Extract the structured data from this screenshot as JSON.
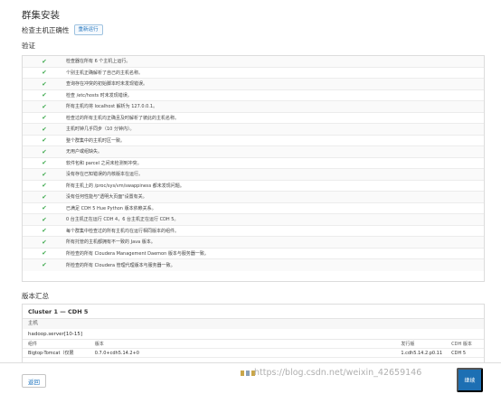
{
  "header": {
    "title": "群集安装",
    "subtitle": "检查主机正确性",
    "rerun_label": "重新运行"
  },
  "validation": {
    "heading": "验证",
    "checks": [
      "检查器在所有 6 个主机上运行。",
      "个别主机正确解析了自己的主机名称。",
      "查询存在冲突的初始脚本时未发现错误。",
      "检查 /etc/hosts 时未发现错误。",
      "所有主机均将 localhost 解析为 127.0.0.1。",
      "检查过的所有主机均正确且及时解析了彼此的主机名称。",
      "主机时钟几乎同步（10 分钟内）。",
      "整个群集中的主机时区一致。",
      "无用户或组缺失。",
      "软件包和 parcel 之间未检测到冲突。",
      "没有存在已知错误的内核版本在运行。",
      "所有主机上的 /proc/sys/vm/swappiness 都未发现问题。",
      "没有任何性能与\"透明大页面\"设置有关。",
      "已满足 CDH 5 Hue Python 版本依赖关系。",
      "0 台主机正在运行 CDH 4，6 台主机正在运行 CDH 5。",
      "每个群集中检查过的所有主机均在运行相同版本的组件。",
      "所有托管的主机都拥有不一致的 Java 版本。",
      "所检查的所有 Cloudera Management Daemon 版本与服务器一致。",
      "所检查的所有 Cloudera 管理代理版本与服务器一致。"
    ]
  },
  "summary": {
    "heading": "版本汇总",
    "cluster_title": "Cluster 1 — CDH 5",
    "hosts_heading": "主机",
    "hosts_value": "hadoop.server[10-15]",
    "columns": [
      "组件",
      "版本",
      "发行版",
      "CDH 版本"
    ],
    "rows": [
      [
        "Bigtop-Tomcat（仅限",
        "0.7.0+cdh5.14.2+0",
        "1.cdh5.14.2.p0.11",
        "CDH 5"
      ]
    ]
  },
  "footer": {
    "back_label": "返回",
    "watermark": "https://blog.csdn.net/weixin_42659146",
    "continue_label": "继续"
  }
}
